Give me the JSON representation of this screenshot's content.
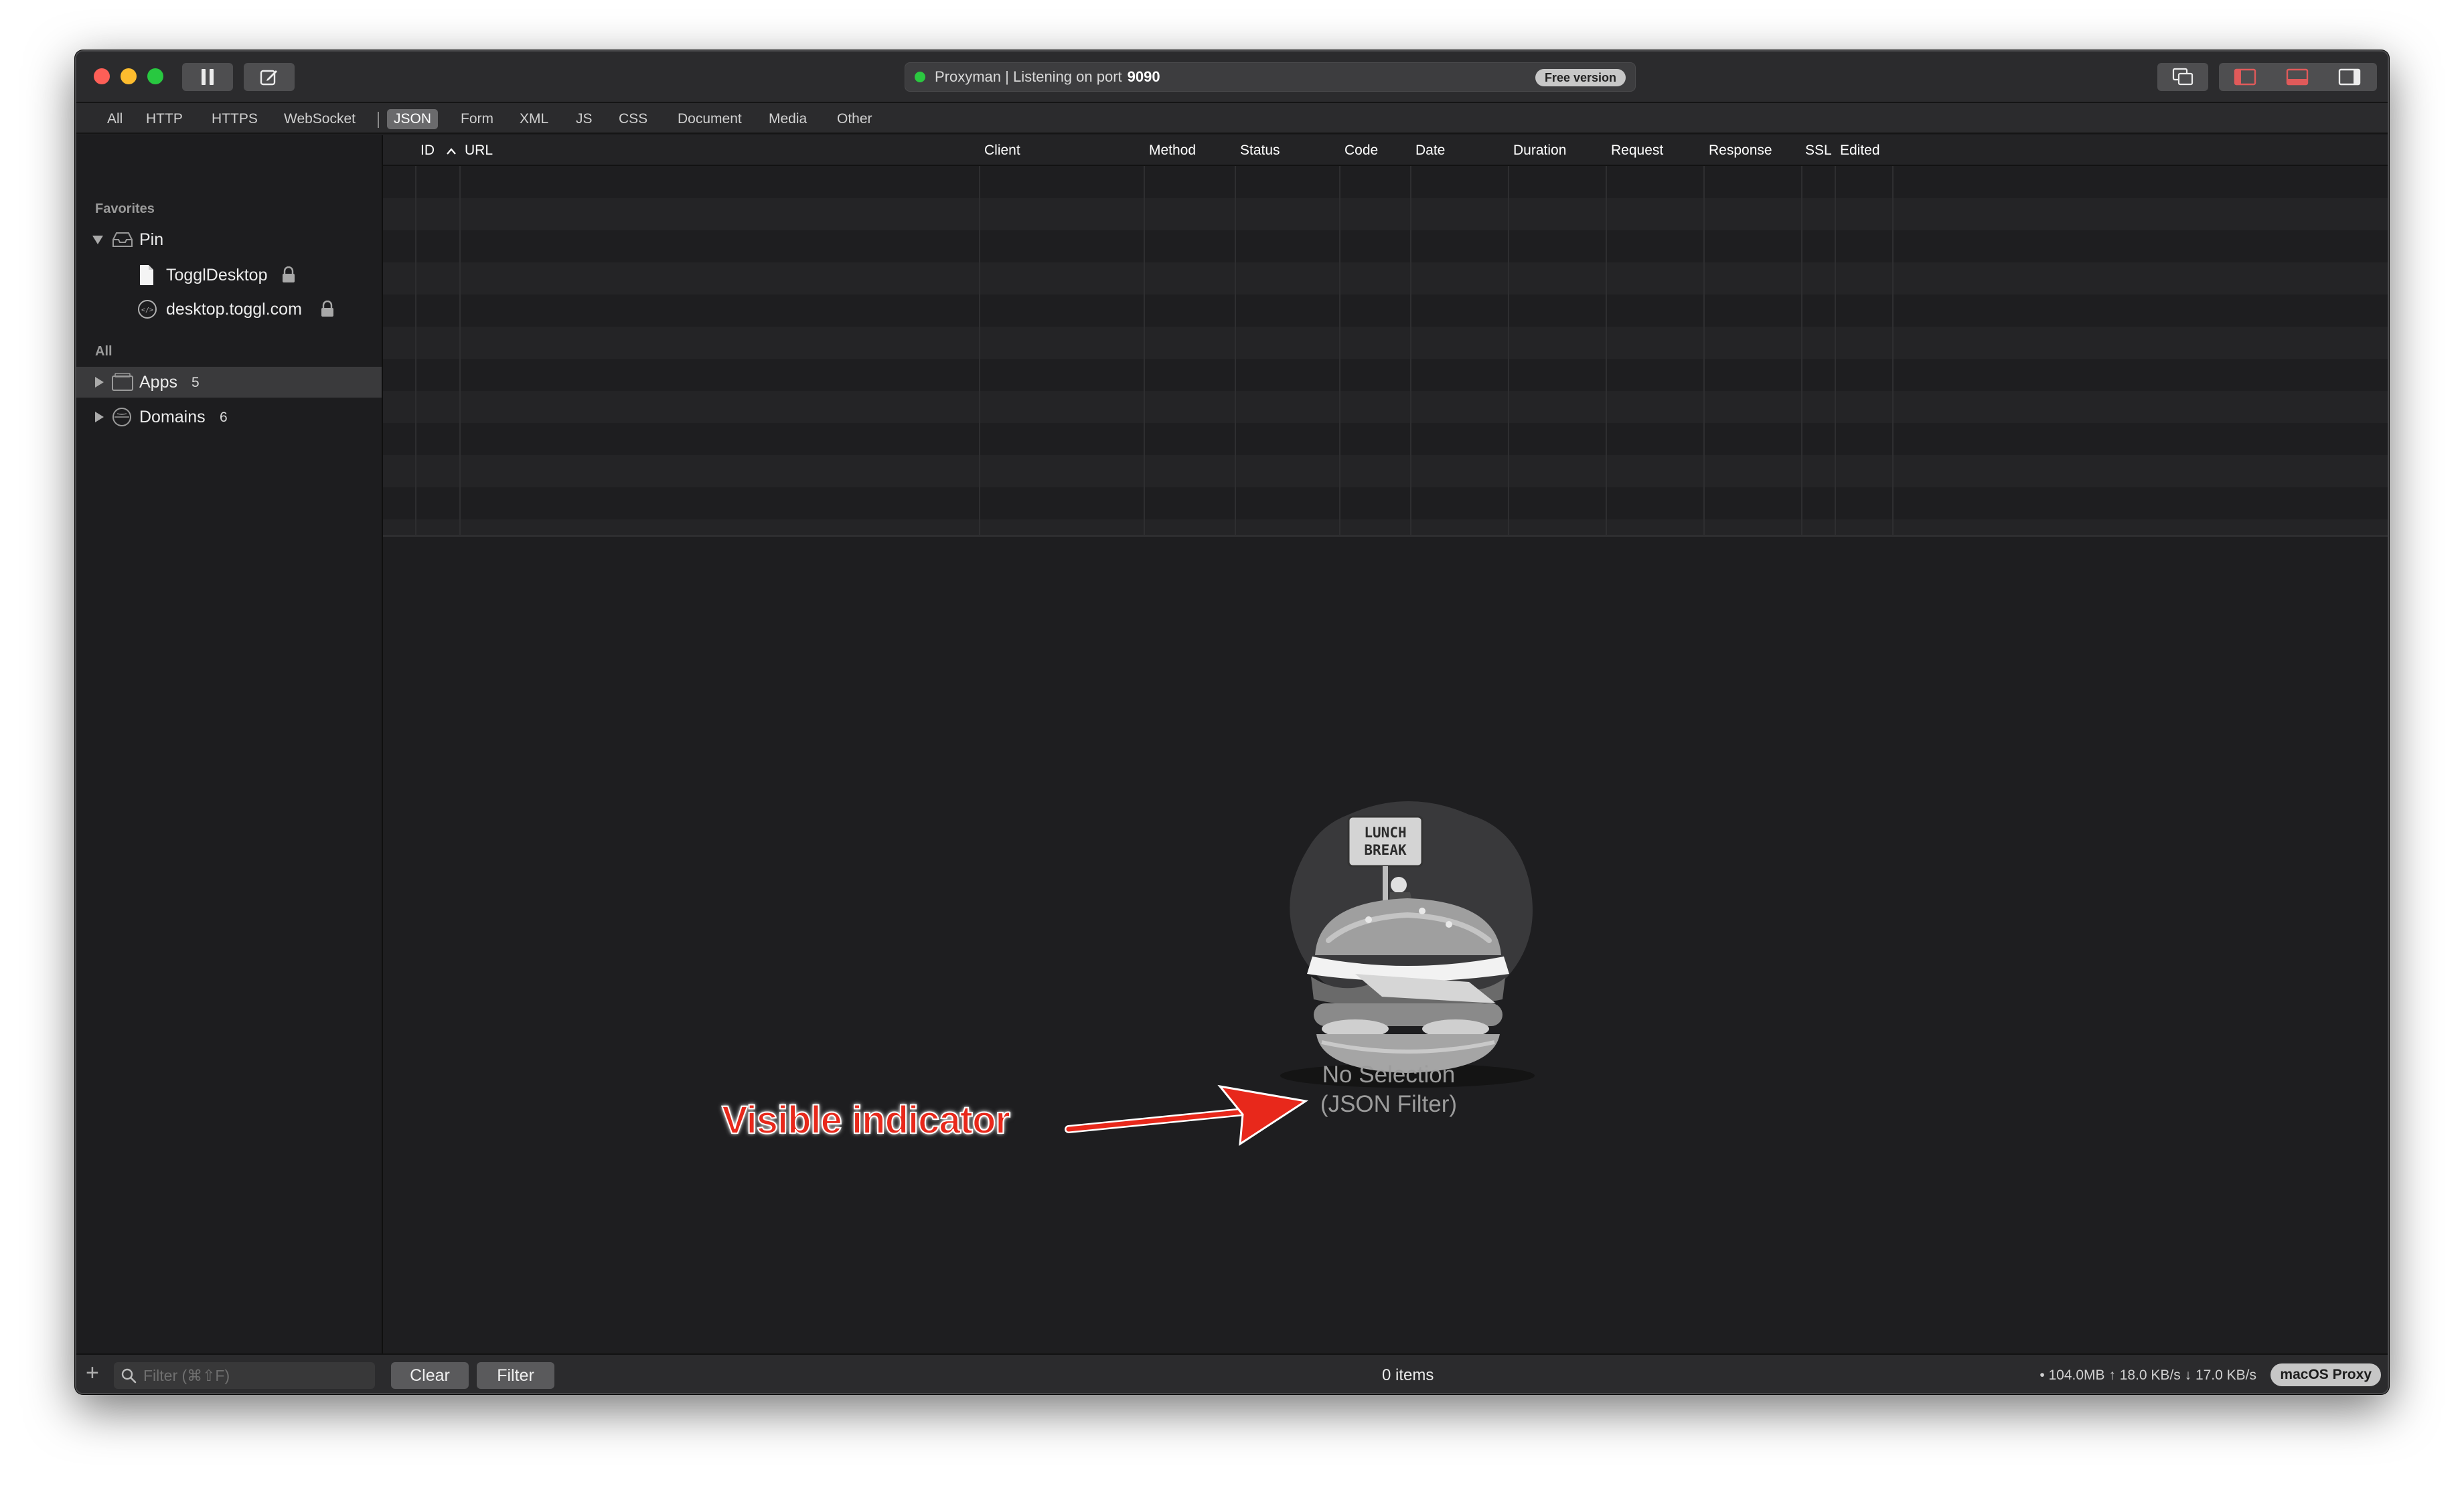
{
  "window": {
    "status_text": "Proxyman | Listening on port",
    "status_port": "9090",
    "license_badge": "Free version"
  },
  "filter_tabs": [
    "All",
    "HTTP",
    "HTTPS",
    "WebSocket",
    "JSON",
    "Form",
    "XML",
    "JS",
    "CSS",
    "Document",
    "Media",
    "Other"
  ],
  "active_tab": "JSON",
  "sidebar": {
    "favorites_header": "Favorites",
    "pin": {
      "label": "Pin",
      "children": [
        {
          "label": "TogglDesktop",
          "icon": "file-icon",
          "locked": true
        },
        {
          "label": "desktop.toggl.com",
          "icon": "code-globe-icon",
          "locked": true
        }
      ]
    },
    "all_header": "All",
    "groups": [
      {
        "label": "Apps",
        "count": "5",
        "icon": "apps-folder-icon"
      },
      {
        "label": "Domains",
        "count": "6",
        "icon": "globe-icon"
      }
    ]
  },
  "table": {
    "columns": [
      "ID",
      "URL",
      "Client",
      "Method",
      "Status",
      "Code",
      "Date",
      "Duration",
      "Request",
      "Response",
      "SSL",
      "Edited"
    ],
    "rows": []
  },
  "empty_state": {
    "title": "No Selection",
    "subtitle": "(JSON Filter)",
    "illustration": "lunch-break-burger",
    "sign_line1": "LUNCH",
    "sign_line2": "BREAK"
  },
  "annotation": {
    "text": "Visible indicator",
    "color": "#e8281b"
  },
  "bottom_bar": {
    "filter_placeholder": "Filter (⌘⇧F)",
    "clear_label": "Clear",
    "filter_label": "Filter",
    "items_count": "0 items",
    "stats": "• 104.0MB ↑ 18.0 KB/s ↓ 17.0 KB/s",
    "proxy_badge": "macOS Proxy"
  },
  "colors": {
    "status_dot": "#2bc840",
    "panel_icon_accent": "#e05a5a"
  }
}
